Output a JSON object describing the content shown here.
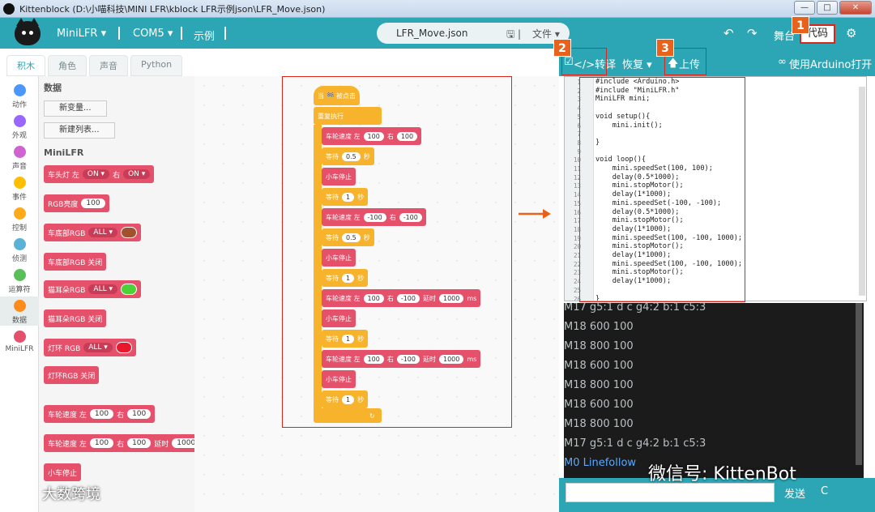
{
  "window": {
    "title": "Kittenblock (D:\\小喵科技\\MINI LFR\\kblock LFR示例json\\LFR_Move.json)",
    "min": "—",
    "max": "□",
    "close": "✕"
  },
  "menubar": {
    "device": "MiniLFR ▾",
    "port": "COM5 ▾",
    "examples": "示例",
    "filename": "LFR_Move.json",
    "file_menu": "文件 ▾",
    "stage": "舞台",
    "code": "代码",
    "badge1": "1"
  },
  "tabs": [
    "积木",
    "角色",
    "声音",
    "Python"
  ],
  "categories": [
    {
      "label": "动作",
      "color": "#4c97ff"
    },
    {
      "label": "外观",
      "color": "#9966ff"
    },
    {
      "label": "声音",
      "color": "#cf63cf"
    },
    {
      "label": "事件",
      "color": "#ffbf00"
    },
    {
      "label": "控制",
      "color": "#ffab19"
    },
    {
      "label": "侦测",
      "color": "#5cb1d6"
    },
    {
      "label": "运算符",
      "color": "#59c059"
    },
    {
      "label": "数据",
      "color": "#ff8c1a"
    },
    {
      "label": "MiniLFR",
      "color": "#e5506b"
    }
  ],
  "palette": {
    "data_header": "数据",
    "new_var": "新变量...",
    "new_list": "新建列表...",
    "minilfr_header": "MiniLFR",
    "blocks": [
      {
        "text": "车头灯 左",
        "extra": [
          "ON ▾",
          "右",
          "ON ▾"
        ]
      },
      {
        "text": "RGB亮度",
        "extra": [
          "100"
        ]
      },
      {
        "text": "车底部RGB",
        "extra": [
          "ALL ▾"
        ]
      },
      {
        "text": "车底部RGB 关闭",
        "extra": []
      },
      {
        "text": "猫耳朵RGB",
        "extra": [
          "ALL ▾"
        ]
      },
      {
        "text": "猫耳朵RGB 关闭",
        "extra": []
      },
      {
        "text": "灯环 RGB",
        "extra": [
          "ALL ▾"
        ]
      },
      {
        "text": "灯环RGB 关闭",
        "extra": []
      },
      {
        "text": "车轮速度 左",
        "extra": [
          "100",
          "右",
          "100"
        ]
      },
      {
        "text": "车轮速度 左",
        "extra": [
          "100",
          "右",
          "100",
          "延时",
          "1000"
        ]
      },
      {
        "text": "小车停止",
        "extra": []
      }
    ],
    "colors": [
      "#a0522d",
      "#4cd137",
      "#e8192c"
    ]
  },
  "script": {
    "hat": "当 🏁 被点击",
    "forever": "重复执行",
    "blocks": [
      {
        "kind": "r",
        "parts": [
          "车轮速度 左",
          "100",
          "右",
          "100"
        ]
      },
      {
        "kind": "o",
        "parts": [
          "等待",
          "0.5",
          "秒"
        ]
      },
      {
        "kind": "r",
        "parts": [
          "小车停止"
        ]
      },
      {
        "kind": "o",
        "parts": [
          "等待",
          "1",
          "秒"
        ]
      },
      {
        "kind": "r",
        "parts": [
          "车轮速度 左",
          "-100",
          "右",
          "-100"
        ]
      },
      {
        "kind": "o",
        "parts": [
          "等待",
          "0.5",
          "秒"
        ]
      },
      {
        "kind": "r",
        "parts": [
          "小车停止"
        ]
      },
      {
        "kind": "o",
        "parts": [
          "等待",
          "1",
          "秒"
        ]
      },
      {
        "kind": "r",
        "parts": [
          "车轮速度 左",
          "100",
          "右",
          "-100",
          "延时",
          "1000",
          "ms"
        ]
      },
      {
        "kind": "r",
        "parts": [
          "小车停止"
        ]
      },
      {
        "kind": "o",
        "parts": [
          "等待",
          "1",
          "秒"
        ]
      },
      {
        "kind": "r",
        "parts": [
          "车轮速度 左",
          "100",
          "右",
          "-100",
          "延时",
          "1000",
          "ms"
        ]
      },
      {
        "kind": "r",
        "parts": [
          "小车停止"
        ]
      },
      {
        "kind": "o",
        "parts": [
          "等待",
          "1",
          "秒"
        ]
      }
    ]
  },
  "right_toolbar": {
    "translate": "</>转译",
    "restore": "恢复 ▾",
    "upload": "上传",
    "arduino": "使用Arduino打开",
    "badge2": "2",
    "badge3": "3"
  },
  "code_lines": [
    "#include <Arduino.h>",
    "#include \"MiniLFR.h\"",
    "MiniLFR mini;",
    "",
    "void setup(){",
    "    mini.init();",
    "",
    "}",
    "",
    "void loop(){",
    "    mini.speedSet(100, 100);",
    "    delay(0.5*1000);",
    "    mini.stopMotor();",
    "    delay(1*1000);",
    "    mini.speedSet(-100, -100);",
    "    delay(0.5*1000);",
    "    mini.stopMotor();",
    "    delay(1*1000);",
    "    mini.speedSet(100, -100, 1000);",
    "    mini.stopMotor();",
    "    delay(1*1000);",
    "    mini.speedSet(100, -100, 1000);",
    "    mini.stopMotor();",
    "    delay(1*1000);",
    "",
    "}"
  ],
  "console_lines": [
    "M17 g5:1 d c g4:2 b:1 c5:3",
    "M18 600 100",
    "M18 800 100",
    "M18 600 100",
    "M18 800 100",
    "M18 600 100",
    "M18 800 100",
    "M17 g5:1 d c g4:2 b:1 c5:3",
    "M0 Linefollow"
  ],
  "send": {
    "button": "发送",
    "clear": "C"
  },
  "watermarks": {
    "wechat": "微信号: KittenBot",
    "corner": "大数跨境"
  }
}
